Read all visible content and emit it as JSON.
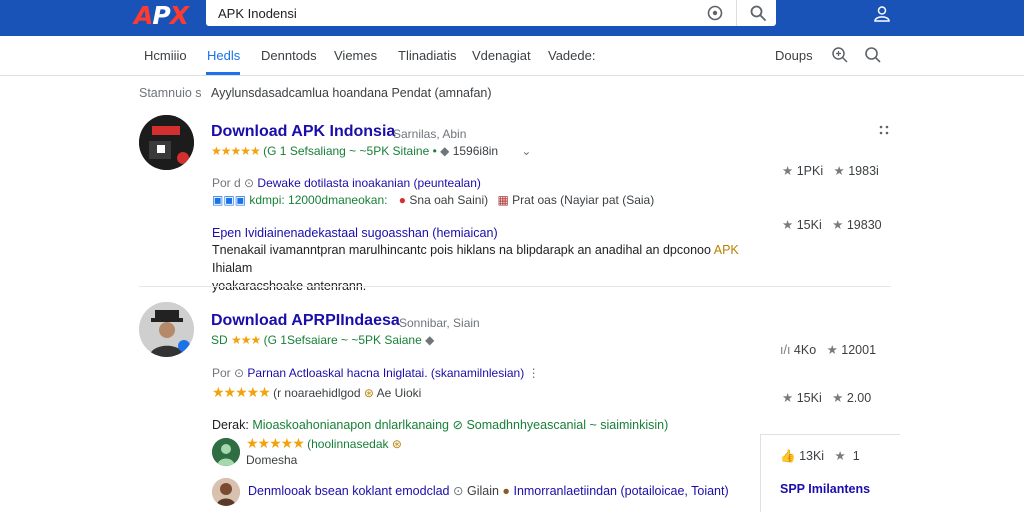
{
  "header": {
    "logo_parts": [
      "A",
      "P",
      "X"
    ],
    "search_value": "APK Inodensi"
  },
  "nav": {
    "tabs": [
      "Hcmiiio",
      "Hedls",
      "Denntods",
      "Viemes",
      "Tlinadiatis",
      "Vdenagiat",
      "Vadede:"
    ],
    "right_label": "Doups"
  },
  "results_meta": {
    "stats": "Stamnuio s",
    "query_text": "Ayylunsdasadcamlua hoandana Pendat (amnafan)"
  },
  "result1": {
    "title": "Download APK Indonsia",
    "title_meta": "Sarnilas, Abin",
    "rating_line": "(G 1 Sefsaliang ~ ~5PK Sitaine  •",
    "count": "1596i8in",
    "sub_prefix": "Por d ⊙",
    "sub_title": "Dewake dotilasta inoakanian (peuntealan)",
    "meta_green": "kdmpi: 12000dmaneokan:",
    "meta_mid": "Sna oah Saini)",
    "meta_right": "Prat oas (Nayiar pat (Saia)",
    "snippet_heading": "Epen  Ividiainenadekastaal sugoasshan (hemiaican)",
    "snippet_line1": "Tnenakail ivamanntpran marulhincantc pois hiklans na blipdarapk an anadihal an dpconoo",
    "snippet_apk": "APK",
    "snippet_line1_end": "Ihialam",
    "snippet_line2": "yoakaracshoake antenrann.",
    "stats_a": [
      "1PKi",
      "1983i"
    ],
    "stats_b": [
      "15Ki",
      "19830"
    ]
  },
  "result2": {
    "title": "Download APRPIIndaesa",
    "title_meta": "Sonnibar, Siain",
    "rating_prefix": "SD",
    "rating_line": "(G 1Sefsaiare ~ ~5PK Saiane",
    "sub_prefix": "Por ⊙",
    "sub_title": "Parnan Actloaskal hacna Iniglatai. (skanamilnlesian)",
    "rating2_text": "(r noaraehidlgod",
    "rating2_right": "Ae Uioki",
    "heading_dark": "Derak:",
    "heading_green": "Mioaskoahonianapon dnlarlkanaing",
    "heading_green2": "Somadhnhyeascanial ~ siaiminkisin)",
    "nested_rating": "(hoolinnasedak",
    "nested_label": "Domesha",
    "last_title": "Denmlooak bsean koklant emodclad",
    "last_mid": "Gilain",
    "last_right": "Inmorranlaetiindan (potailoicae, Toiant)",
    "stats_a": [
      "4Ko",
      "12001"
    ],
    "stats_b": [
      "15Ki",
      "2.00"
    ],
    "stats_c": [
      "13Ki",
      "1"
    ],
    "side_link": "SPP Imilantens"
  },
  "colors": {
    "header_blue": "#1a53b8",
    "link_blue": "#1a0dab",
    "accent_blue": "#1a73e8",
    "green": "#188038",
    "star_gold": "#f2a20d"
  }
}
